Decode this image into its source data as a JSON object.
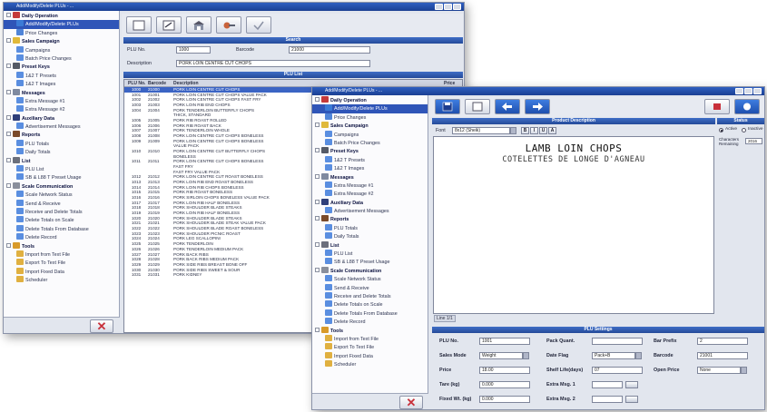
{
  "window1": {
    "title": "Add/Modify/Delete PLUs - ...",
    "tree": [
      {
        "label": "Daily Operation",
        "level": 0,
        "top": true,
        "icon": "#c43a3a",
        "icon_name": "daily-operation-icon"
      },
      {
        "label": "Add/Modify/Delete PLUs",
        "level": 1,
        "sel": true,
        "icon": "#3b7bd6",
        "icon_name": "plu-icon"
      },
      {
        "label": "Price Changes",
        "level": 1,
        "icon": "#4f84d8",
        "icon_name": "price-change-icon"
      },
      {
        "label": "Sales Campaign",
        "level": 0,
        "top": true,
        "icon": "#e0b93a",
        "icon_name": "star-icon"
      },
      {
        "label": "Campaigns",
        "level": 1,
        "icon": "#5a8ee0",
        "icon_name": "campaign-icon"
      },
      {
        "label": "Batch Price Changes",
        "level": 1,
        "icon": "#5a8ee0",
        "icon_name": "batch-icon"
      },
      {
        "label": "Preset Keys",
        "level": 0,
        "top": true,
        "icon": "#555a66",
        "icon_name": "keyboard-icon"
      },
      {
        "label": "1&2 T Presets",
        "level": 1,
        "icon": "#5a8ee0",
        "icon_name": "preset-icon"
      },
      {
        "label": "1&2 T Images",
        "level": 1,
        "icon": "#5a8ee0",
        "icon_name": "image-icon"
      },
      {
        "label": "Messages",
        "level": 0,
        "top": true,
        "icon": "#7f8aa0",
        "icon_name": "message-icon"
      },
      {
        "label": "Extra Message #1",
        "level": 1,
        "icon": "#5a8ee0",
        "icon_name": "message-icon"
      },
      {
        "label": "Extra Message #2",
        "level": 1,
        "icon": "#5a8ee0",
        "icon_name": "message-icon"
      },
      {
        "label": "Auxiliary Data",
        "level": 0,
        "top": true,
        "icon": "#2f3f7a",
        "icon_name": "auxiliary-icon"
      },
      {
        "label": "Advertisement Messages",
        "level": 1,
        "icon": "#5a8ee0",
        "icon_name": "advert-icon"
      },
      {
        "label": "Reports",
        "level": 0,
        "top": true,
        "icon": "#7a4a2a",
        "icon_name": "reports-icon"
      },
      {
        "label": "PLU Totals",
        "level": 1,
        "icon": "#5a8ee0",
        "icon_name": "totals-icon"
      },
      {
        "label": "Daily Totals",
        "level": 1,
        "icon": "#5a8ee0",
        "icon_name": "totals-icon"
      },
      {
        "label": "List",
        "level": 0,
        "top": true,
        "icon": "#6b6f7c",
        "icon_name": "list-icon"
      },
      {
        "label": "PLU List",
        "level": 1,
        "icon": "#5a8ee0",
        "icon_name": "list-icon"
      },
      {
        "label": "SB & L88 T Preset Usage",
        "level": 1,
        "icon": "#5a8ee0",
        "icon_name": "usage-icon"
      },
      {
        "label": "Scale Communication",
        "level": 0,
        "top": true,
        "icon": "#8a8f9c",
        "icon_name": "scale-icon"
      },
      {
        "label": "Scale Network Status",
        "level": 1,
        "icon": "#5a8ee0",
        "icon_name": "network-icon"
      },
      {
        "label": "Send & Receive",
        "level": 1,
        "icon": "#5a8ee0",
        "icon_name": "send-icon"
      },
      {
        "label": "Receive and Delete Totals",
        "level": 1,
        "icon": "#5a8ee0",
        "icon_name": "receive-icon"
      },
      {
        "label": "Delete Totals on Scale",
        "level": 1,
        "icon": "#5a8ee0",
        "icon_name": "delete-icon"
      },
      {
        "label": "Delete Totals From Database",
        "level": 1,
        "icon": "#5a8ee0",
        "icon_name": "delete-icon"
      },
      {
        "label": "Delete Record",
        "level": 1,
        "icon": "#5a8ee0",
        "icon_name": "delete-icon"
      },
      {
        "label": "Tools",
        "level": 0,
        "top": true,
        "icon": "#d89a2a",
        "icon_name": "tools-icon"
      },
      {
        "label": "Import from Text File",
        "level": 1,
        "icon": "#e0b040",
        "icon_name": "import-icon"
      },
      {
        "label": "Export To Text File",
        "level": 1,
        "icon": "#e0b040",
        "icon_name": "export-icon"
      },
      {
        "label": "Import Fixed Data",
        "level": 1,
        "icon": "#e0b040",
        "icon_name": "import-icon"
      },
      {
        "label": "Scheduler",
        "level": 1,
        "icon": "#e0b040",
        "icon_name": "scheduler-icon"
      }
    ],
    "search": {
      "header": "Search",
      "plu_label": "PLU No.",
      "plu_value": "1000",
      "barcode_label": "Barcode",
      "barcode_value": "21000",
      "description_label": "Description",
      "description_value": "PORK LOIN CENTRE CUT CHOPS"
    },
    "list": {
      "header": "PLU List",
      "columns": [
        "PLU No.",
        "Barcode",
        "Description",
        "Price"
      ],
      "rows": [
        [
          "1000",
          "21000",
          "PORK LOIN CENTRE CUT CHOPS"
        ],
        [
          "1001",
          "21001",
          "PORK LOIN CENTRE CUT CHOPS VALUE PACK"
        ],
        [
          "1002",
          "21002",
          "PORK LOIN CENTRE CUT CHOPS FAST FRY"
        ],
        [
          "1003",
          "21003",
          "PORK LOIN RIB END CHOPS"
        ],
        [
          "1004",
          "21004",
          "PORK TENDERLOIN BUTTERFLY CHOPS"
        ],
        [
          "",
          "",
          "THICK, STANDARD"
        ],
        [
          "1005",
          "21005",
          "PORK RIB ROAST ROLLED"
        ],
        [
          "1006",
          "21006",
          "PORK RIB ROAST BACK"
        ],
        [
          "1007",
          "21007",
          "PORK TENDERLOIN WHOLE"
        ],
        [
          "1008",
          "21008",
          "PORK LOIN CENTRE CUT CHOPS BONELESS"
        ],
        [
          "1009",
          "21009",
          "PORK LOIN CENTRE CUT CHOPS BONELESS"
        ],
        [
          "",
          "",
          "VALUE PACK"
        ],
        [
          "1010",
          "21010",
          "PORK LOIN CENTRE CUT BUTTERFLY CHOPS"
        ],
        [
          "",
          "",
          "BONELESS"
        ],
        [
          "1011",
          "21011",
          "PORK LOIN CENTRE CUT CHOPS BONELESS"
        ],
        [
          "",
          "",
          "FAST FRY"
        ],
        [
          "",
          "",
          "FAST FRY VALUE PACK"
        ],
        [
          "1012",
          "21012",
          "PORK LOIN CENTRE CUT ROAST BONELESS"
        ],
        [
          "1013",
          "21013",
          "PORK LOIN RIB END ROAST BONELESS"
        ],
        [
          "1014",
          "21014",
          "PORK LOIN RIB CHOPS BONELESS"
        ],
        [
          "1015",
          "21015",
          "PORK RIB ROAST BONELESS"
        ],
        [
          "1016",
          "21016",
          "PORK SIRLOIN CHOPS BONELESS VALUE PACK"
        ],
        [
          "1017",
          "21017",
          "PORK LOIN RIB HALF BONELESS"
        ],
        [
          "1018",
          "21018",
          "PORK SHOULDER BLADE STEAKS"
        ],
        [
          "1019",
          "21019",
          "PORK LOIN RIB HALF BONELESS"
        ],
        [
          "1020",
          "21020",
          "PORK SHOULDER BLADE STEAKS"
        ],
        [
          "1021",
          "21021",
          "PORK SHOULDER BLADE STEAK VALUE PACK"
        ],
        [
          "1022",
          "21022",
          "PORK SHOULDER BLADE ROAST BONELESS"
        ],
        [
          "1023",
          "21023",
          "PORK SHOULDER PICNIC ROAST"
        ],
        [
          "1024",
          "21024",
          "PORK LEG SCALLOPINI"
        ],
        [
          "1025",
          "21025",
          "PORK TENDERLOIN"
        ],
        [
          "1026",
          "21026",
          "PORK TENDERLOIN MEDIUM PACK"
        ],
        [
          "1027",
          "21027",
          "PORK BACK RIBS"
        ],
        [
          "1028",
          "21028",
          "PORK BACK RIBS MEDIUM PACK"
        ],
        [
          "1029",
          "21029",
          "PORK SIDE RIBS BREAST BONE OFF"
        ],
        [
          "1030",
          "21030",
          "PORK SIDE RIBS SWEET & SOUR"
        ],
        [
          "1031",
          "21031",
          "PORK KIDNEY"
        ]
      ]
    }
  },
  "window2": {
    "title": "Add/Modify/Delete PLUs - ...",
    "tree": [
      {
        "label": "Daily Operation",
        "level": 0,
        "top": true,
        "icon": "#c43a3a",
        "icon_name": "daily-operation-icon"
      },
      {
        "label": "Add/Modify/Delete PLUs",
        "level": 1,
        "sel": true,
        "icon": "#3b7bd6",
        "icon_name": "plu-icon"
      },
      {
        "label": "Price Changes",
        "level": 1,
        "icon": "#4f84d8",
        "icon_name": "price-change-icon"
      },
      {
        "label": "Sales Campaign",
        "level": 0,
        "top": true,
        "icon": "#e0b93a",
        "icon_name": "star-icon"
      },
      {
        "label": "Campaigns",
        "level": 1,
        "icon": "#5a8ee0",
        "icon_name": "campaign-icon"
      },
      {
        "label": "Batch Price Changes",
        "level": 1,
        "icon": "#5a8ee0",
        "icon_name": "batch-icon"
      },
      {
        "label": "Preset Keys",
        "level": 0,
        "top": true,
        "icon": "#555a66",
        "icon_name": "keyboard-icon"
      },
      {
        "label": "1&2 T Presets",
        "level": 1,
        "icon": "#5a8ee0",
        "icon_name": "preset-icon"
      },
      {
        "label": "1&2 T Images",
        "level": 1,
        "icon": "#5a8ee0",
        "icon_name": "image-icon"
      },
      {
        "label": "Messages",
        "level": 0,
        "top": true,
        "icon": "#7f8aa0",
        "icon_name": "message-icon"
      },
      {
        "label": "Extra Message #1",
        "level": 1,
        "icon": "#5a8ee0",
        "icon_name": "message-icon"
      },
      {
        "label": "Extra Message #2",
        "level": 1,
        "icon": "#5a8ee0",
        "icon_name": "message-icon"
      },
      {
        "label": "Auxiliary Data",
        "level": 0,
        "top": true,
        "icon": "#2f3f7a",
        "icon_name": "auxiliary-icon"
      },
      {
        "label": "Advertisement Messages",
        "level": 1,
        "icon": "#5a8ee0",
        "icon_name": "advert-icon"
      },
      {
        "label": "Reports",
        "level": 0,
        "top": true,
        "icon": "#7a4a2a",
        "icon_name": "reports-icon"
      },
      {
        "label": "PLU Totals",
        "level": 1,
        "icon": "#5a8ee0",
        "icon_name": "totals-icon"
      },
      {
        "label": "Daily Totals",
        "level": 1,
        "icon": "#5a8ee0",
        "icon_name": "totals-icon"
      },
      {
        "label": "List",
        "level": 0,
        "top": true,
        "icon": "#6b6f7c",
        "icon_name": "list-icon"
      },
      {
        "label": "PLU List",
        "level": 1,
        "icon": "#5a8ee0",
        "icon_name": "list-icon"
      },
      {
        "label": "SB & L88 T Preset Usage",
        "level": 1,
        "icon": "#5a8ee0",
        "icon_name": "usage-icon"
      },
      {
        "label": "Scale Communication",
        "level": 0,
        "top": true,
        "icon": "#8a8f9c",
        "icon_name": "scale-icon"
      },
      {
        "label": "Scale Network Status",
        "level": 1,
        "icon": "#5a8ee0",
        "icon_name": "network-icon"
      },
      {
        "label": "Send & Receive",
        "level": 1,
        "icon": "#5a8ee0",
        "icon_name": "send-icon"
      },
      {
        "label": "Receive and Delete Totals",
        "level": 1,
        "icon": "#5a8ee0",
        "icon_name": "receive-icon"
      },
      {
        "label": "Delete Totals on Scale",
        "level": 1,
        "icon": "#5a8ee0",
        "icon_name": "delete-icon"
      },
      {
        "label": "Delete Totals From Database",
        "level": 1,
        "icon": "#5a8ee0",
        "icon_name": "delete-icon"
      },
      {
        "label": "Delete Record",
        "level": 1,
        "icon": "#5a8ee0",
        "icon_name": "delete-icon"
      },
      {
        "label": "Tools",
        "level": 0,
        "top": true,
        "icon": "#d89a2a",
        "icon_name": "tools-icon"
      },
      {
        "label": "Import from Text File",
        "level": 1,
        "icon": "#e0b040",
        "icon_name": "import-icon"
      },
      {
        "label": "Export To Text File",
        "level": 1,
        "icon": "#e0b040",
        "icon_name": "export-icon"
      },
      {
        "label": "Import Fixed Data",
        "level": 1,
        "icon": "#e0b040",
        "icon_name": "import-icon"
      },
      {
        "label": "Scheduler",
        "level": 1,
        "icon": "#e0b040",
        "icon_name": "scheduler-icon"
      }
    ],
    "product_description": {
      "header": "Product Description",
      "font_label": "Font",
      "font_value": "8x12 (Sheik)",
      "format_buttons": [
        "B",
        "I",
        "U",
        "A"
      ],
      "line1": "LAMB LOIN CHOPS",
      "line2": "COTELETTES DE LONGE D'AGNEAU",
      "status_text": "Line 1/1"
    },
    "status": {
      "header": "Status",
      "active_label": "Active",
      "inactive_label": "Inactive",
      "chars_label": "Characters Remaining",
      "chars_value": "2016"
    },
    "settings": {
      "header": "PLU Settings",
      "fields": [
        {
          "label": "PLU No.",
          "value": "1001"
        },
        {
          "label": "Pack Quant.",
          "value": ""
        },
        {
          "label": "Bar Prefix",
          "value": "2"
        },
        {
          "label": "Sales Mode",
          "value": "Weight",
          "dropdown": true
        },
        {
          "label": "Date Flag",
          "value": "Pack+B",
          "dropdown": true
        },
        {
          "label": "Barcode",
          "value": "21001"
        },
        {
          "label": "Price",
          "value": "18.00"
        },
        {
          "label": "Shelf Life(days)",
          "value": "07"
        },
        {
          "label": "Open Price",
          "value": "None",
          "dropdown": true
        },
        {
          "label": "Tare (kg)",
          "value": "0.000"
        },
        {
          "label": "Extra Msg. 1",
          "value": ""
        },
        {
          "label": "Fixed Wt. (kg)",
          "value": "0.000"
        },
        {
          "label": "Extra Msg. 2",
          "value": ""
        }
      ]
    }
  }
}
